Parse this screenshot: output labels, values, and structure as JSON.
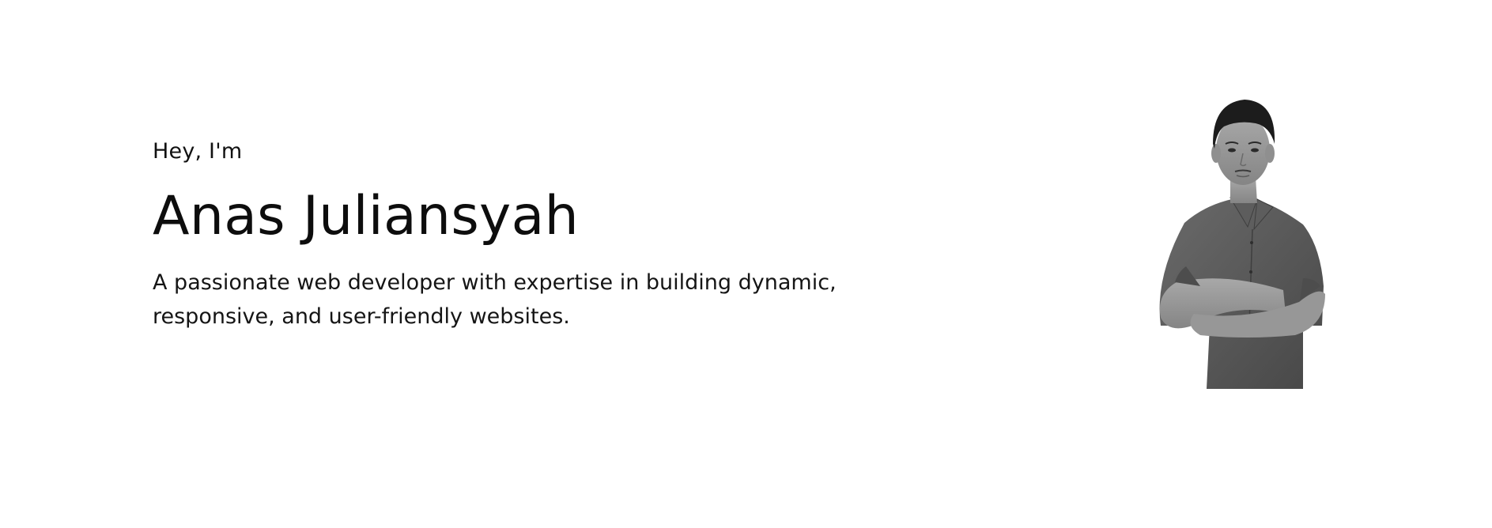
{
  "hero": {
    "greeting": "Hey, I'm",
    "name": "Anas Juliansyah",
    "bio": "A passionate web developer with expertise in building dynamic, responsive, and user-friendly websites."
  },
  "portrait": {
    "icon": "profile-photo",
    "shirt_color": "#555555",
    "skin_color": "#9a9a9a",
    "hair_color": "#1c1c1c"
  }
}
